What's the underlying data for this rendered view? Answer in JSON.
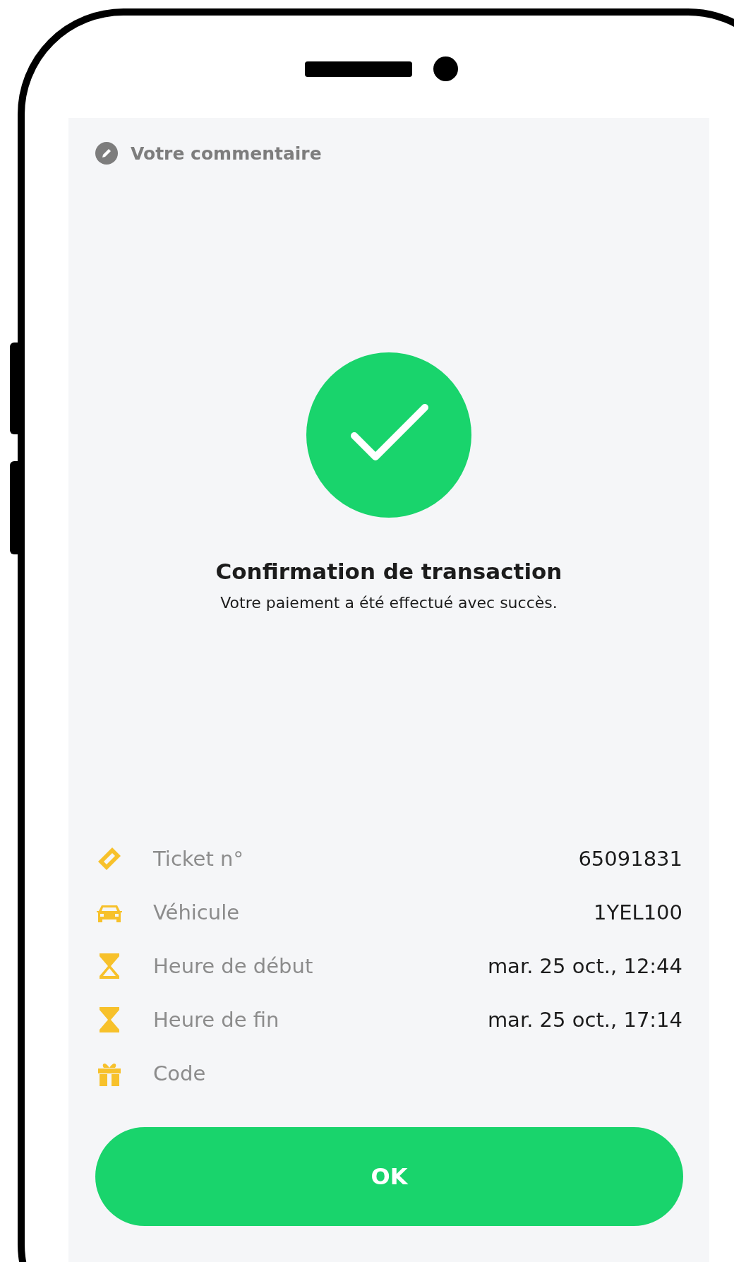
{
  "comment": {
    "placeholder": "Votre commentaire"
  },
  "confirmation": {
    "title": "Confirmation de transaction",
    "message": "Votre paiement a été effectué avec succès."
  },
  "details": [
    {
      "kind": "ticket",
      "label": "Ticket n°",
      "value": "65091831"
    },
    {
      "kind": "car",
      "label": "Véhicule",
      "value": "1YEL100"
    },
    {
      "kind": "hourglass-start",
      "label": "Heure de début",
      "value": "mar. 25 oct., 12:44"
    },
    {
      "kind": "hourglass-end",
      "label": "Heure de fin",
      "value": "mar. 25 oct., 17:14"
    },
    {
      "kind": "gift",
      "label": "Code"
    }
  ],
  "button": {
    "label": "OK"
  }
}
